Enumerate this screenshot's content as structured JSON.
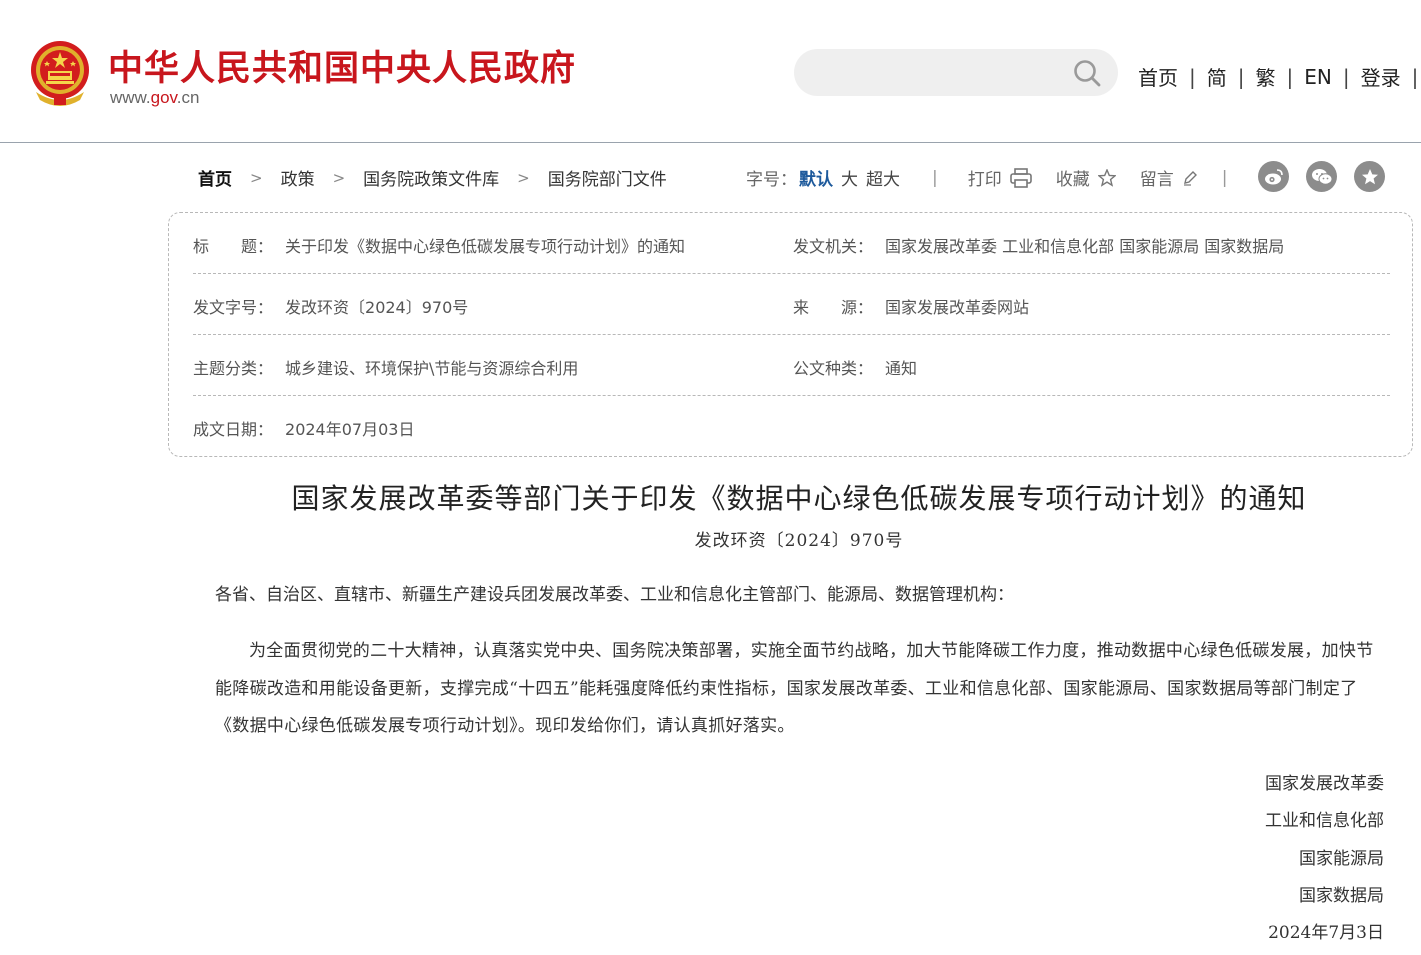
{
  "header": {
    "site_title": "中华人民共和国中央人民政府",
    "site_url_prefix": "www.",
    "site_url_brand": "gov",
    "site_url_suffix": ".cn",
    "search_placeholder": "",
    "nav": [
      {
        "label": "首页"
      },
      {
        "label": "简"
      },
      {
        "label": "繁"
      },
      {
        "label": "EN"
      },
      {
        "label": "登录"
      }
    ],
    "brand_color": "#c8161d"
  },
  "breadcrumb": [
    "首页",
    "政策",
    "国务院政策文件库",
    "国务院部门文件"
  ],
  "toolbar": {
    "font_size_label": "字号：",
    "font_sizes": [
      "默认",
      "大",
      "超大"
    ],
    "print": "打印",
    "favorite": "收藏",
    "comment": "留言",
    "share_icons": [
      "weibo-icon",
      "wechat-icon",
      "star-share-icon"
    ]
  },
  "meta": {
    "title_label": "标　　题：",
    "title_value": "关于印发《数据中心绿色低碳发展专项行动计划》的通知",
    "issuer_label": "发文机关：",
    "issuer_value": "国家发展改革委 工业和信息化部 国家能源局 国家数据局",
    "docno_label": "发文字号：",
    "docno_value": "发改环资〔2024〕970号",
    "source_label": "来　　源：",
    "source_value": "国家发展改革委网站",
    "topic_label": "主题分类：",
    "topic_value": "城乡建设、环境保护\\节能与资源综合利用",
    "type_label": "公文种类：",
    "type_value": "通知",
    "date_label": "成文日期：",
    "date_value": "2024年07月03日"
  },
  "article": {
    "title": "国家发展改革委等部门关于印发《数据中心绿色低碳发展专项行动计划》的通知",
    "docno": "发改环资〔2024〕970号",
    "addressee": "各省、自治区、直辖市、新疆生产建设兵团发展改革委、工业和信息化主管部门、能源局、数据管理机构：",
    "paragraph": "为全面贯彻党的二十大精神，认真落实党中央、国务院决策部署，实施全面节约战略，加大节能降碳工作力度，推动数据中心绿色低碳发展，加快节能降碳改造和用能设备更新，支撑完成“十四五”能耗强度降低约束性指标，国家发展改革委、工业和信息化部、国家能源局、国家数据局等部门制定了《数据中心绿色低碳发展专项行动计划》。现印发给你们，请认真抓好落实。",
    "signatures": [
      "国家发展改革委",
      "工业和信息化部",
      "国家能源局",
      "国家数据局",
      "2024年7月3日"
    ]
  }
}
